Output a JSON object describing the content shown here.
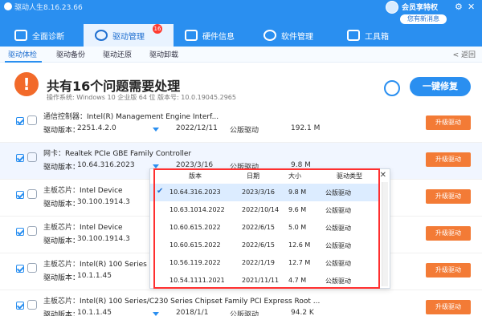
{
  "header": {
    "title": "驱动人生8.16.23.66",
    "vip": {
      "label": "会员享特权",
      "message": "您有新消息"
    },
    "window_buttons": {
      "settings": "⚙",
      "menu": "☰",
      "minimize": "—",
      "close": "✕"
    },
    "tabs": [
      {
        "label": "全面诊断"
      },
      {
        "label": "驱动管理",
        "badge": "16"
      },
      {
        "label": "硬件信息"
      },
      {
        "label": "软件管理"
      },
      {
        "label": "工具箱"
      }
    ]
  },
  "subnav": {
    "items": [
      "驱动体检",
      "驱动备份",
      "驱动还原",
      "驱动卸载"
    ],
    "back": "< 返回"
  },
  "summary": {
    "title": "共有16个问题需要处理",
    "subtitle": "操作系统: Windows 10 企业版 64 位    版本号: 10.0.19045.2965",
    "fix_button": "一键修复"
  },
  "list": {
    "rows": [
      {
        "category": "通信控制器：",
        "name": "Intel(R) Management Engine Interf...",
        "version_label": "驱动版本：",
        "version": "2251.4.2.0",
        "date": "2022/12/11",
        "type": "公版驱动",
        "size": "192.1 M",
        "button": "升级驱动"
      },
      {
        "category": "网卡：",
        "name": "Realtek PCIe GBE Family Controller",
        "version_label": "驱动版本：",
        "version": "10.64.316.2023",
        "date": "2023/3/16",
        "type": "公版驱动",
        "size": "9.8 M",
        "button": "升级驱动"
      },
      {
        "category": "主板芯片：",
        "name": "Intel Device",
        "version_label": "驱动版本：",
        "version": "30.100.1914.3",
        "date": "",
        "type": "",
        "size": "",
        "button": "升级驱动"
      },
      {
        "category": "主板芯片：",
        "name": "Intel Device",
        "version_label": "驱动版本：",
        "version": "30.100.1914.3",
        "date": "",
        "type": "",
        "size": "",
        "button": "升级驱动"
      },
      {
        "category": "主板芯片：",
        "name": "Intel(R) 100 Series",
        "version_label": "驱动版本：",
        "version": "10.1.1.45",
        "date": "",
        "type": "",
        "size": "",
        "button": "升级驱动"
      },
      {
        "category": "主板芯片：",
        "name": "Intel(R) 100 Series/C230 Series Chipset Family PCI Express Root ...",
        "version_label": "驱动版本：",
        "version": "10.1.1.45",
        "date": "2018/1/1",
        "type": "公版驱动",
        "size": "94.2 K",
        "button": "升级驱动"
      }
    ]
  },
  "dropdown": {
    "headers": [
      "版本",
      "日期",
      "大小",
      "驱动类型"
    ],
    "rows": [
      {
        "version": "10.64.316.2023",
        "date": "2023/3/16",
        "size": "9.8 M",
        "type": "公版驱动",
        "selected": true
      },
      {
        "version": "10.63.1014.2022",
        "date": "2022/10/14",
        "size": "9.6 M",
        "type": "公版驱动",
        "selected": false
      },
      {
        "version": "10.60.615.2022",
        "date": "2022/6/15",
        "size": "5.0 M",
        "type": "公版驱动",
        "selected": false
      },
      {
        "version": "10.60.615.2022",
        "date": "2022/6/15",
        "size": "12.6 M",
        "type": "公版驱动",
        "selected": false
      },
      {
        "version": "10.56.119.2022",
        "date": "2022/1/19",
        "size": "12.7 M",
        "type": "公版驱动",
        "selected": false
      },
      {
        "version": "10.54.1111.2021",
        "date": "2021/11/11",
        "size": "4.7 M",
        "type": "公版驱动",
        "selected": false
      }
    ],
    "close": "✕",
    "check": "✔"
  },
  "colors": {
    "accent": "#2a8ff0",
    "warning": "#f26a2a",
    "upgrade": "#f37b36",
    "outline": "#ff2f2f"
  }
}
